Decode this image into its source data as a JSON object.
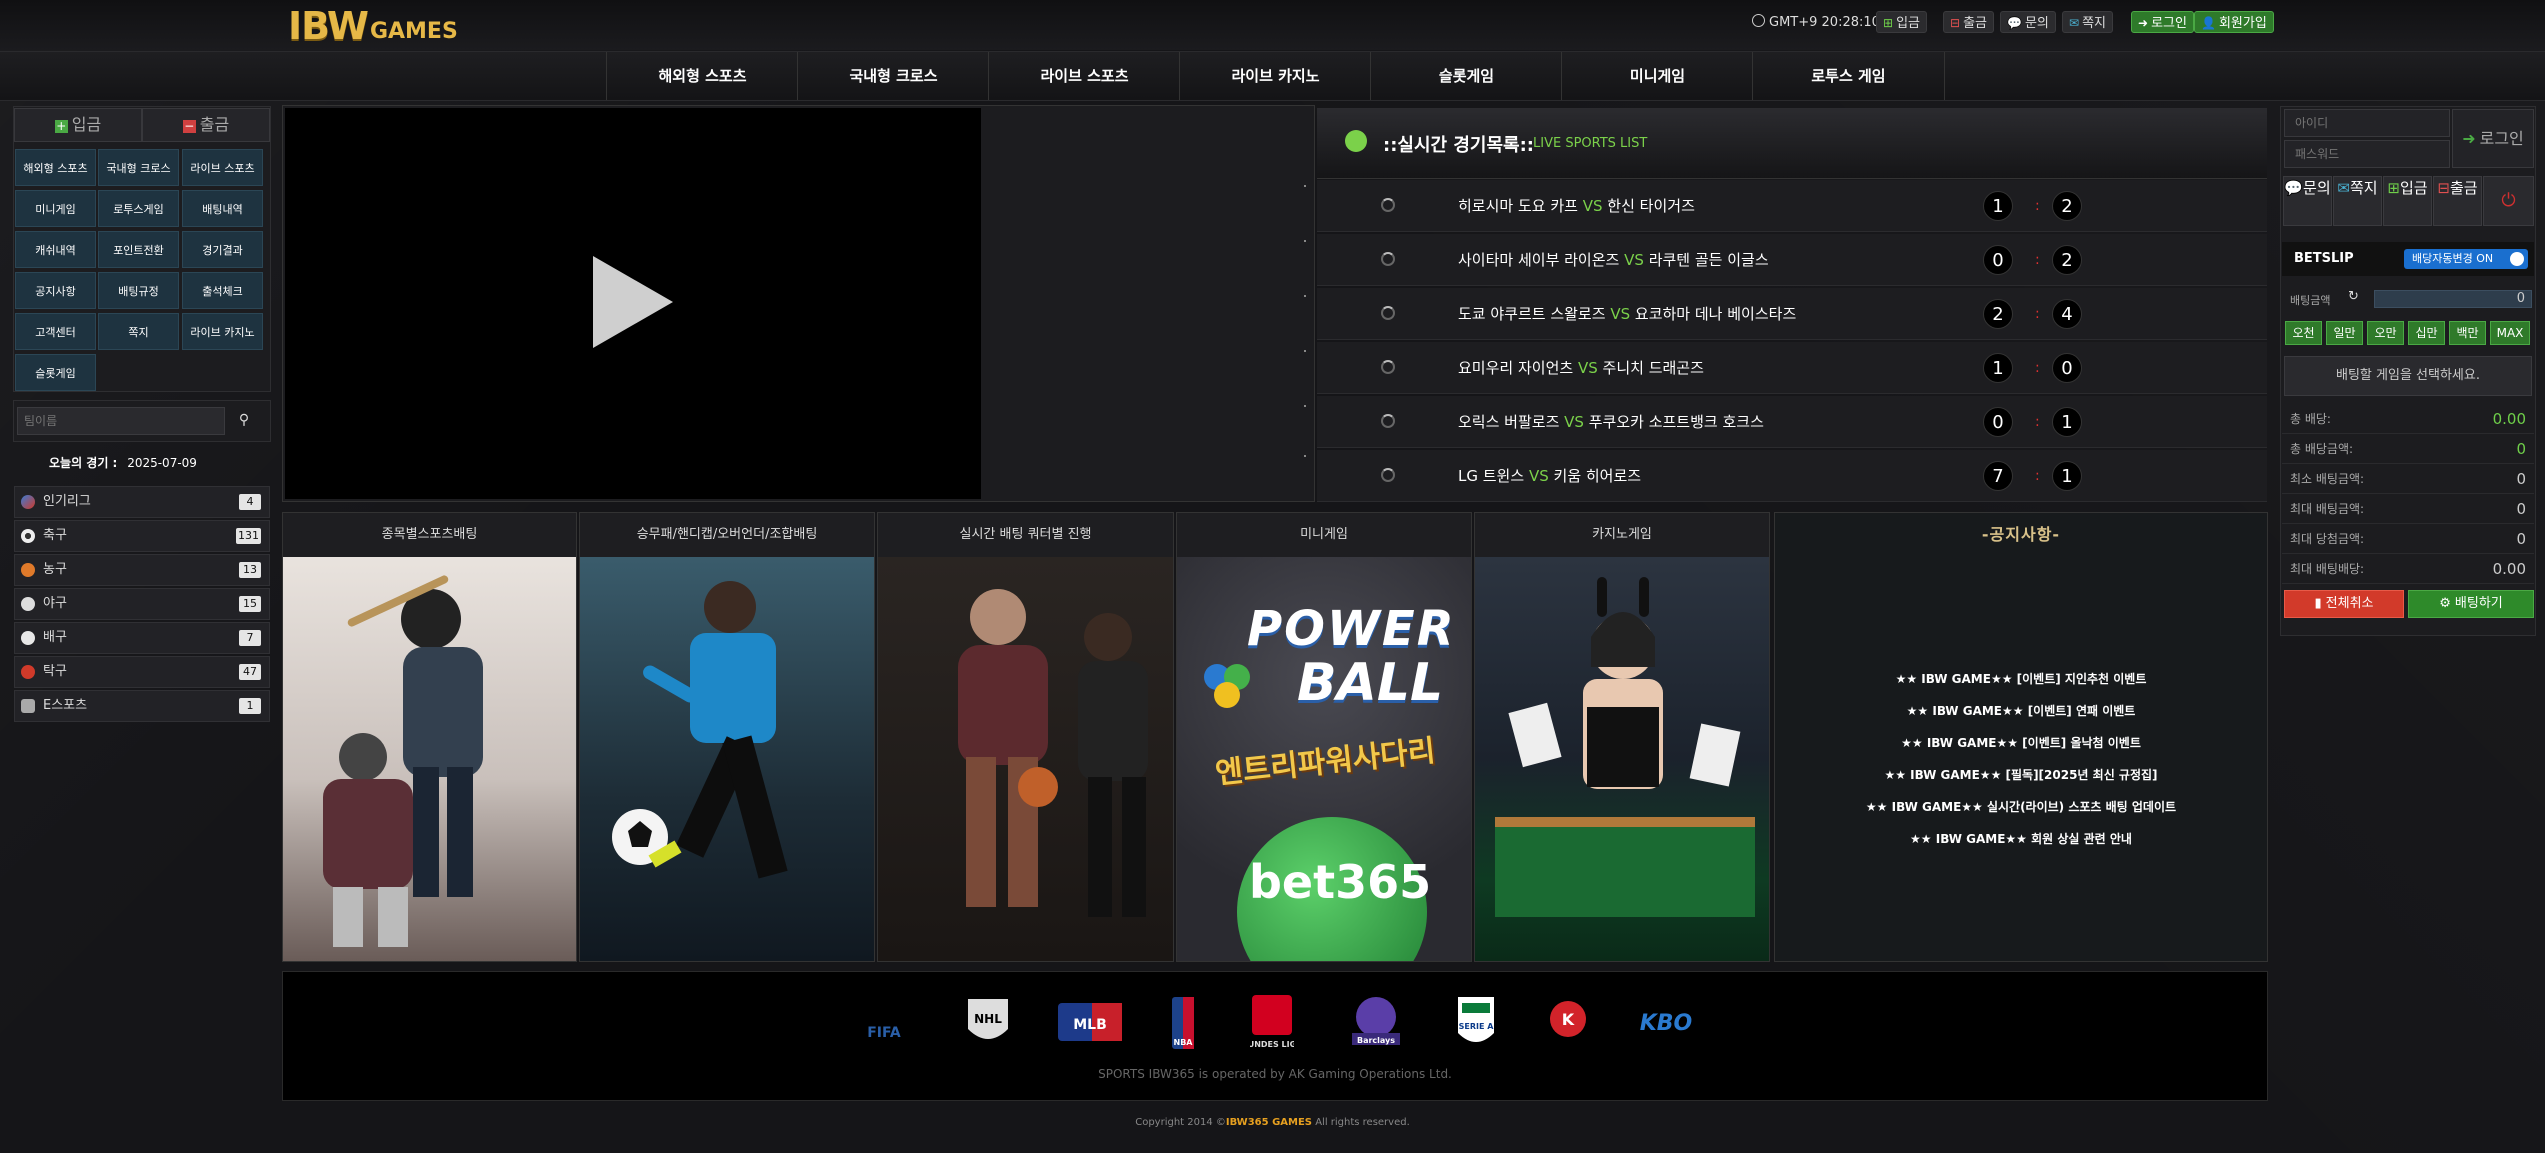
{
  "header": {
    "logo_big": "IBW",
    "logo_small": "GAMES",
    "clock": "GMT+9 20:28:10",
    "deposit": "입금",
    "withdraw": "출금",
    "inquiry": "문의",
    "message": "쪽지",
    "login": "로그인",
    "signup": "회원가입"
  },
  "nav": [
    "해외형 스포츠",
    "국내형 크로스",
    "라이브 스포츠",
    "라이브 카지노",
    "슬롯게임",
    "미니게임",
    "로투스 게임"
  ],
  "sidebar": {
    "deposit": "입금",
    "withdraw": "출금",
    "menu": [
      "해외형 스포츠",
      "국내형 크로스",
      "라이브 스포츠",
      "미니게임",
      "로투스게임",
      "배팅내역",
      "캐쉬내역",
      "포인트전환",
      "경기결과",
      "공지사항",
      "배팅규정",
      "출석체크",
      "고객센터",
      "쪽지",
      "라이브 카지노",
      "슬롯게임"
    ],
    "search_placeholder": "팀이름",
    "today_label": "오늘의 경기 :",
    "today_date": "2025-07-09",
    "sports": [
      {
        "name": "인기리그",
        "count": "4",
        "color": "#3a7bd5"
      },
      {
        "name": "축구",
        "count": "131",
        "color": "#eeeeee"
      },
      {
        "name": "농구",
        "count": "13",
        "color": "#e07a2a"
      },
      {
        "name": "야구",
        "count": "15",
        "color": "#dddddd"
      },
      {
        "name": "배구",
        "count": "7",
        "color": "#e8e8e8"
      },
      {
        "name": "탁구",
        "count": "47",
        "color": "#d03a2a"
      },
      {
        "name": "E스포츠",
        "count": "1",
        "color": "#aaaaaa"
      }
    ]
  },
  "live": {
    "title": "::실시간 경기목록::",
    "subtitle": "LIVE SPORTS LIST",
    "vs": "VS",
    "colon": ":",
    "matches": [
      {
        "home": "히로시마 도요 카프",
        "away": "한신 타이거즈",
        "hs": "1",
        "as": "2"
      },
      {
        "home": "사이타마 세이부 라이온즈",
        "away": "라쿠텐 골든 이글스",
        "hs": "0",
        "as": "2"
      },
      {
        "home": "도쿄 야쿠르트 스왈로즈",
        "away": "요코하마 데나 베이스타즈",
        "hs": "2",
        "as": "4"
      },
      {
        "home": "요미우리 자이언츠",
        "away": "주니치 드래곤즈",
        "hs": "1",
        "as": "0"
      },
      {
        "home": "오릭스 버팔로즈",
        "away": "푸쿠오카 소프트뱅크 호크스",
        "hs": "0",
        "as": "1"
      },
      {
        "home": "LG 트윈스",
        "away": "키움 히어로즈",
        "hs": "7",
        "as": "1"
      }
    ]
  },
  "cards": [
    "종목별스포츠배팅",
    "승무패/핸디캡/오버언더/조합배팅",
    "실시간 배팅 쿼터별 진행",
    "미니게임",
    "카지노게임"
  ],
  "card_text": {
    "power": "POWER",
    "ball": "BALL",
    "entry": "엔트리파워사다리",
    "bet365": "bet365"
  },
  "notices": {
    "title": "-공지사항-",
    "items": [
      "★★ IBW GAME★★ [이벤트] 지인추천 이벤트",
      "★★ IBW GAME★★ [이벤트] 연패 이벤트",
      "★★ IBW GAME★★ [이벤트] 올낙첨 이벤트",
      "★★ IBW GAME★★ [필독][2025년 최신 규정집]",
      "★★ IBW GAME★★ 실시간(라이브) 스포츠 배팅 업데이트",
      "★★ IBW GAME★★ 회원 상실 관련 안내"
    ]
  },
  "right": {
    "id_placeholder": "아이디",
    "pw_placeholder": "패스워드",
    "login": "로그인",
    "btn_inquiry": "문의",
    "btn_message": "쪽지",
    "btn_deposit": "입금",
    "btn_withdraw": "출금",
    "betslip": "BETSLIP",
    "auto_toggle": "배당자동변경 ON",
    "bet_amount_label": "배팅금액",
    "bet_amount_value": "0",
    "chips": [
      "오천",
      "일만",
      "오만",
      "십만",
      "백만",
      "MAX"
    ],
    "select_msg": "배팅할 게임을 선택하세요.",
    "summary": [
      {
        "label": "총 배당:",
        "value": "0.00",
        "color": "#6fcf4a"
      },
      {
        "label": "총 배당금액:",
        "value": "0",
        "color": "#6fcf4a"
      },
      {
        "label": "최소 배팅금액:",
        "value": "0",
        "color": "#cccccc"
      },
      {
        "label": "최대 배팅금액:",
        "value": "0",
        "color": "#cccccc"
      },
      {
        "label": "최대 당첨금액:",
        "value": "0",
        "color": "#cccccc"
      },
      {
        "label": "최대 배팅배당:",
        "value": "0.00",
        "color": "#cccccc"
      }
    ],
    "cancel_all": "전체취소",
    "place_bet": "배팅하기"
  },
  "footer": {
    "logos": [
      "FIFA",
      "NHL",
      "MLB",
      "NBA",
      "BUNDES LIGA",
      "Barclays",
      "SERIE A",
      "K",
      "KBO"
    ],
    "operated": "SPORTS IBW365 is operated by AK Gaming Operations Ltd.",
    "copy_prefix": "Copyright 2014 ©",
    "copy_brand": "IBW365 GAMES",
    "copy_suffix": " All rights reserved."
  }
}
